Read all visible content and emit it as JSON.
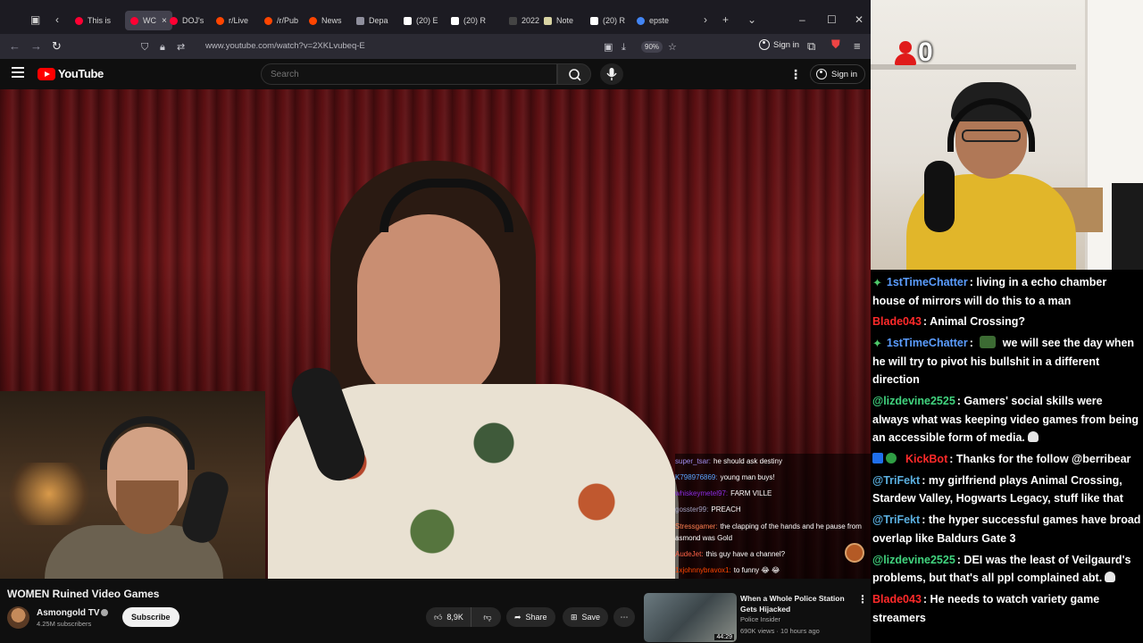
{
  "browser": {
    "tabs": [
      {
        "label": "This is",
        "icon": "youtube-icon",
        "color": "#ff0033"
      },
      {
        "label": "WC",
        "icon": "youtube-icon",
        "color": "#ff0033",
        "active": true
      },
      {
        "label": "DOJ's",
        "icon": "youtube-icon",
        "color": "#ff0033"
      },
      {
        "label": "r/Live",
        "icon": "reddit-icon",
        "color": "#ff4500"
      },
      {
        "label": "/r/Pub",
        "icon": "reddit-icon",
        "color": "#ff4500"
      },
      {
        "label": "News",
        "icon": "reddit-icon",
        "color": "#ff4500"
      },
      {
        "label": "Depa",
        "icon": "globe-icon",
        "color": "#8f8f9d"
      },
      {
        "label": "(20) E",
        "icon": "x-icon",
        "color": "#ffffff"
      },
      {
        "label": "(20) R",
        "icon": "x-icon",
        "color": "#ffffff"
      },
      {
        "label": "2022",
        "icon": "blank-icon",
        "color": "#444444"
      },
      {
        "label": "Note",
        "icon": "note-icon",
        "color": "#d8d3a3"
      },
      {
        "label": "(20) R",
        "icon": "x-icon",
        "color": "#ffffff"
      },
      {
        "label": "epste",
        "icon": "google-icon",
        "color": "#4285f4"
      }
    ],
    "url": "www.youtube.com/watch?v=2XKLvubeq-E",
    "zoom": "90%",
    "signin_label": "Sign in"
  },
  "youtube": {
    "logo_text": "YouTube",
    "search_placeholder": "Search",
    "signin_label": "Sign in",
    "video": {
      "title": "WOMEN Ruined Video Games",
      "channel": "Asmongold TV",
      "subscribers": "4.25M subscribers",
      "subscribe_label": "Subscribe",
      "likes": "8,9K",
      "share_label": "Share",
      "save_label": "Save"
    },
    "overlay_chat": [
      {
        "user": "super_tsar:",
        "user_color": "#9f8cf0",
        "text": "he should ask destiny"
      },
      {
        "user": "K798976869:",
        "user_color": "#5ba3ff",
        "text": "young man buys!"
      },
      {
        "user": "whiskeymetel97:",
        "user_color": "#8a2be2",
        "text": "FARM VILLE"
      },
      {
        "user": "gosster99:",
        "user_color": "#a0a0c0",
        "text": "PREACH"
      },
      {
        "user": "Stressgamer:",
        "user_color": "#ff7f50",
        "text": "the clapping of the hands and he pause from asmond was Gold"
      },
      {
        "user": "AudeJet:",
        "user_color": "#ff6347",
        "text": "this guy have a channel?"
      },
      {
        "user": "1xjohnnybravox1:",
        "user_color": "#ff4500",
        "text": "to funny 😂 😂"
      }
    ],
    "recommendation": {
      "title": "When a Whole Police Station Gets Hijacked",
      "channel": "Police Insider",
      "meta": "690K views · 10 hours ago",
      "duration": "44:29"
    }
  },
  "stream": {
    "viewer_count": "0",
    "chat": [
      {
        "badge": "star",
        "user": "1stTimeChatter",
        "user_color": "#5b9dff",
        "text": ": living in a echo chamber house of mirrors will do this to a man"
      },
      {
        "badge": "",
        "user": "Blade043",
        "user_color": "#ff2a2a",
        "text": ": Animal Crossing?"
      },
      {
        "badge": "star",
        "user": "1stTimeChatter",
        "user_color": "#5b9dff",
        "text": ": ",
        "emote": true,
        "text2": " we will see the day when he will try to pivot his bullshit in a different direction"
      },
      {
        "badge": "",
        "user": "@lizdevine2525",
        "user_color": "#41d37e",
        "text": ": Gamers' social skills were always what was keeping video games from being an accessible form of media.",
        "skull": true
      },
      {
        "badge": "botcheck",
        "user": "KickBot",
        "user_color": "#ff2a2a",
        "text": ": Thanks for the follow @berribear"
      },
      {
        "badge": "",
        "user": "@TriFekt",
        "user_color": "#5bb0e0",
        "text": ": my girlfriend plays Animal Crossing, Stardew Valley, Hogwarts Legacy, stuff like that"
      },
      {
        "badge": "",
        "user": "@TriFekt",
        "user_color": "#5bb0e0",
        "text": ": the hyper successful games have broad overlap like Baldurs Gate 3"
      },
      {
        "badge": "",
        "user": "@lizdevine2525",
        "user_color": "#41d37e",
        "text": ": DEI was the least of Veilgaurd's problems, but that's all ppl complained abt.",
        "skull": true
      },
      {
        "badge": "",
        "user": "Blade043",
        "user_color": "#ff2a2a",
        "text": ": He needs to watch variety game streamers"
      }
    ]
  }
}
